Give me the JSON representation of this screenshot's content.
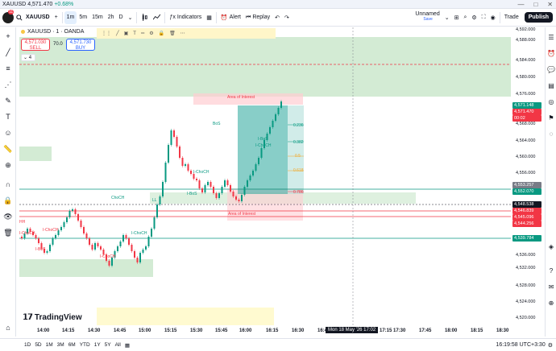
{
  "window": {
    "tab_title_symbol": "XAUUSD",
    "tab_title_price": "4,571.470",
    "tab_title_change": "+0.68%",
    "controls": [
      "—",
      "□",
      "✕"
    ]
  },
  "toolbar": {
    "avatar_badge": "11",
    "symbol": "XAUUSD",
    "intervals": [
      "1m",
      "5m",
      "15m",
      "2h",
      "D"
    ],
    "active_interval": "1m",
    "indicators_label": "Indicators",
    "alert_label": "Alert",
    "replay_label": "Replay",
    "layout_name": "Unnamed",
    "layout_status": "Save",
    "trade_label": "Trade",
    "publish_label": "Publish"
  },
  "legend": {
    "title": "XAUUSD · 1 · OANDA",
    "sell_price": "4,571.030",
    "sell_label": "SELL",
    "spread": "70.0",
    "buy_price": "4,571.730",
    "buy_label": "BUY",
    "collapse_count": "4"
  },
  "chart_labels": {
    "area_of_interest_top": "Area of Interest",
    "area_of_interest_bottom": "Area of Interest",
    "bos": "BoS",
    "choch_main": "ChoCH",
    "fib_0236": "0.236",
    "fib_0382": "0.382",
    "fib_05": "0.5",
    "fib_0618": "0.618",
    "fib_0786": "0.786",
    "i_choch_1": "I-ChoCH",
    "i_choch_2": "I-ChoCH",
    "i_choch_3": "I-ChoCH",
    "i_choch_4": "I-ChoCH",
    "i_choch_5": "I-ChoCH",
    "i_bos_1": "I-BoS",
    "i_bos_2": "I-BoS",
    "i_bos_3": "I-BoS",
    "hh": "HH",
    "ll": "LL",
    "i_choch_left": "I-ChoCH"
  },
  "price_axis": {
    "ticks": [
      "4,592.000",
      "4,588.000",
      "4,584.000",
      "4,580.000",
      "4,576.000",
      "4,568.000",
      "4,564.000",
      "4,560.000",
      "4,556.000",
      "4,536.000",
      "4,532.000",
      "4,528.000",
      "4,524.000",
      "4,520.000"
    ],
    "tags": [
      {
        "text": "4,571.148",
        "color": "#089981"
      },
      {
        "text": "4,571.470",
        "color": "#f23645"
      },
      {
        "text": "00:02",
        "color": "#f23645"
      },
      {
        "text": "4,553.257",
        "color": "#787b86"
      },
      {
        "text": "4,552.070",
        "color": "#089981"
      },
      {
        "text": "4,548.538",
        "color": "#131722"
      },
      {
        "text": "4,546.839",
        "color": "#f23645"
      },
      {
        "text": "4,545.096",
        "color": "#f23645"
      },
      {
        "text": "4,544.256",
        "color": "#f23645"
      },
      {
        "text": "4,539.784",
        "color": "#089981"
      }
    ]
  },
  "time_axis": {
    "ticks": [
      "14:00",
      "14:15",
      "14:30",
      "14:45",
      "15:00",
      "15:15",
      "15:30",
      "15:45",
      "16:00",
      "16:15",
      "16:30",
      "16:45",
      "17:15",
      "17:30",
      "17:45",
      "18:00",
      "18:15",
      "18:30"
    ],
    "cursor_label": "Mon 18 May '26  17:02"
  },
  "brand": "TradingView",
  "bottom": {
    "ranges": [
      "1D",
      "5D",
      "1M",
      "3M",
      "6M",
      "YTD",
      "1Y",
      "5Y",
      "All"
    ],
    "clock": "16:19:58 UTC+3:30"
  },
  "colors": {
    "up": "#089981",
    "down": "#f23645",
    "accent": "#2962ff",
    "zone_green": "#c8e6c9",
    "zone_red": "#ffcdd2"
  }
}
